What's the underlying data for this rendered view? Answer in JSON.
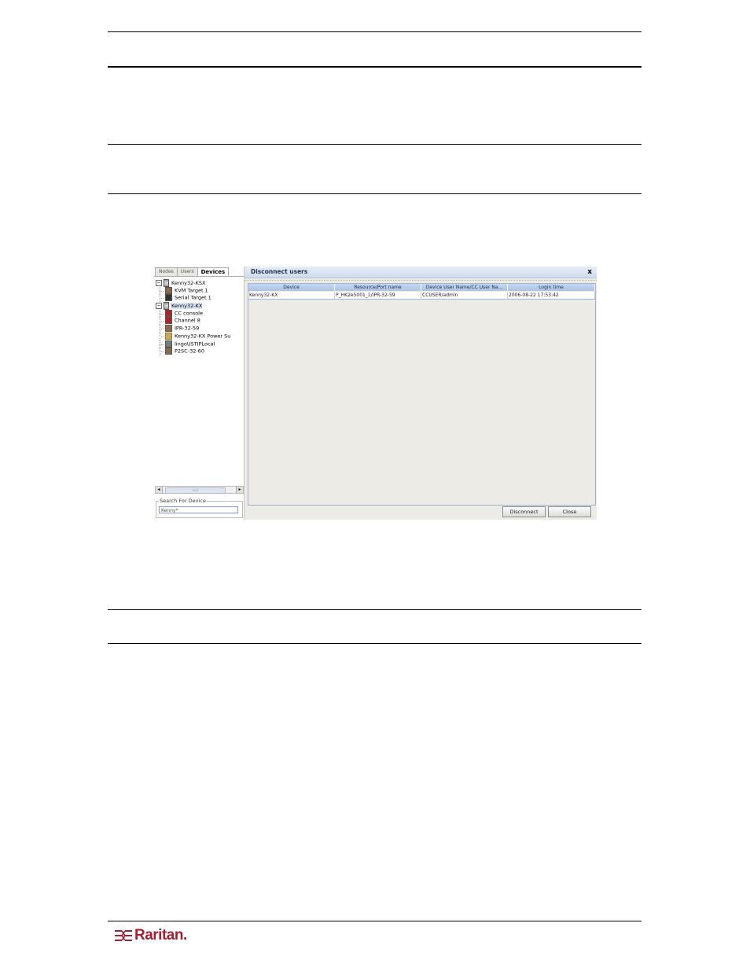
{
  "left_panel": {
    "tabs": [
      "Nodes",
      "Users",
      "Devices"
    ],
    "active_tab": "Devices",
    "tree": [
      {
        "label": "Kenny32-KSX",
        "level": 0,
        "expander": "⊟",
        "icon": "server-icon"
      },
      {
        "label": "KVM Target 1",
        "level": 1,
        "icon": "kvm-port-icon"
      },
      {
        "label": "Serial Target 1",
        "level": 1,
        "icon": "serial-port-icon"
      },
      {
        "label": "Kenny32-KX",
        "level": 0,
        "expander": "⊟",
        "icon": "server-icon",
        "selected": true
      },
      {
        "label": "CC console",
        "level": 1,
        "icon": "kvm-port-red-icon"
      },
      {
        "label": "Channel 8",
        "level": 1,
        "icon": "kvm-port-red-icon"
      },
      {
        "label": "IPR-32-59",
        "level": 1,
        "icon": "kvm-port-icon"
      },
      {
        "label": "Kenny32-KX Power Su",
        "level": 1,
        "icon": "power-strip-icon"
      },
      {
        "label": "lingoUSTIPLocal",
        "level": 1,
        "icon": "kvm-port-icon"
      },
      {
        "label": "P2SC-32-60",
        "level": 1,
        "icon": "kvm-port-icon"
      }
    ],
    "scroll_thumb_text": "ooo",
    "search": {
      "legend": "Search For Device",
      "value": "Kenny*"
    }
  },
  "dialog": {
    "title": "Disconnect users",
    "close_glyph": "x",
    "columns": [
      "Device",
      "Resource/Port name",
      "Device User Name/CC User Na...",
      "Login time"
    ],
    "rows": [
      [
        "Kenny32-KX",
        "P_HK2e5001_1/IPR-32-59",
        "CCUSER/admin",
        "2006-08-22 17:53:42"
      ]
    ],
    "buttons": {
      "disconnect": "Disconnect",
      "close": "Close"
    }
  },
  "footer": {
    "logo_text": "Raritan.",
    "brand_color": "#a32033"
  }
}
